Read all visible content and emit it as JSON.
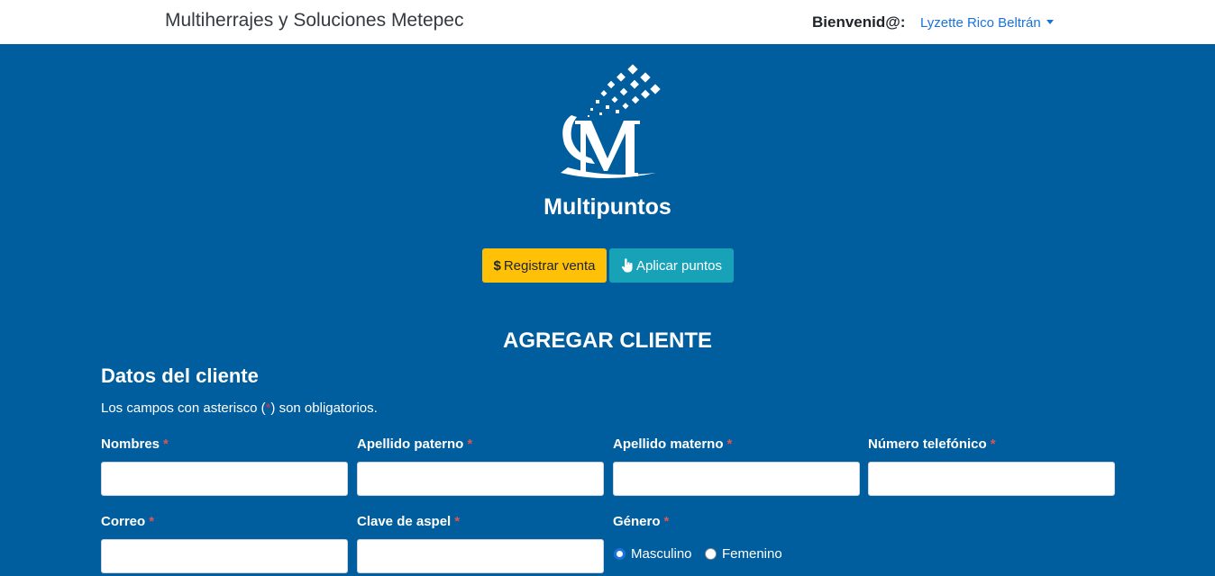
{
  "navbar": {
    "brand": "Multiherrajes y Soluciones Metepec",
    "welcome_label": "Bienvenid@:",
    "user_name": "Lyzette Rico Beltrán"
  },
  "app": {
    "name": "Multipuntos"
  },
  "actions": {
    "register_sale_icon": "$",
    "register_sale_label": "Registrar venta",
    "apply_points_label": "Aplicar puntos"
  },
  "form": {
    "title": "AGREGAR CLIENTE",
    "section_title": "Datos del cliente",
    "note_before": "Los campos con asterisco (",
    "note_asterisk": "*",
    "note_after": ") son obligatorios.",
    "required_mark": "*",
    "fields": {
      "nombres": {
        "label": "Nombres",
        "value": ""
      },
      "apellido_paterno": {
        "label": "Apellido paterno",
        "value": ""
      },
      "apellido_materno": {
        "label": "Apellido materno",
        "value": ""
      },
      "telefono": {
        "label": "Número telefónico",
        "value": ""
      },
      "correo": {
        "label": "Correo",
        "value": ""
      },
      "clave_aspel": {
        "label": "Clave de aspel",
        "value": ""
      }
    },
    "genero": {
      "label": "Género",
      "options": [
        "Masculino",
        "Femenino"
      ],
      "selected": "Masculino"
    }
  },
  "colors": {
    "background": "#005e9e",
    "warning": "#ffc107",
    "info": "#17a2b8",
    "link": "#1a73d9"
  }
}
